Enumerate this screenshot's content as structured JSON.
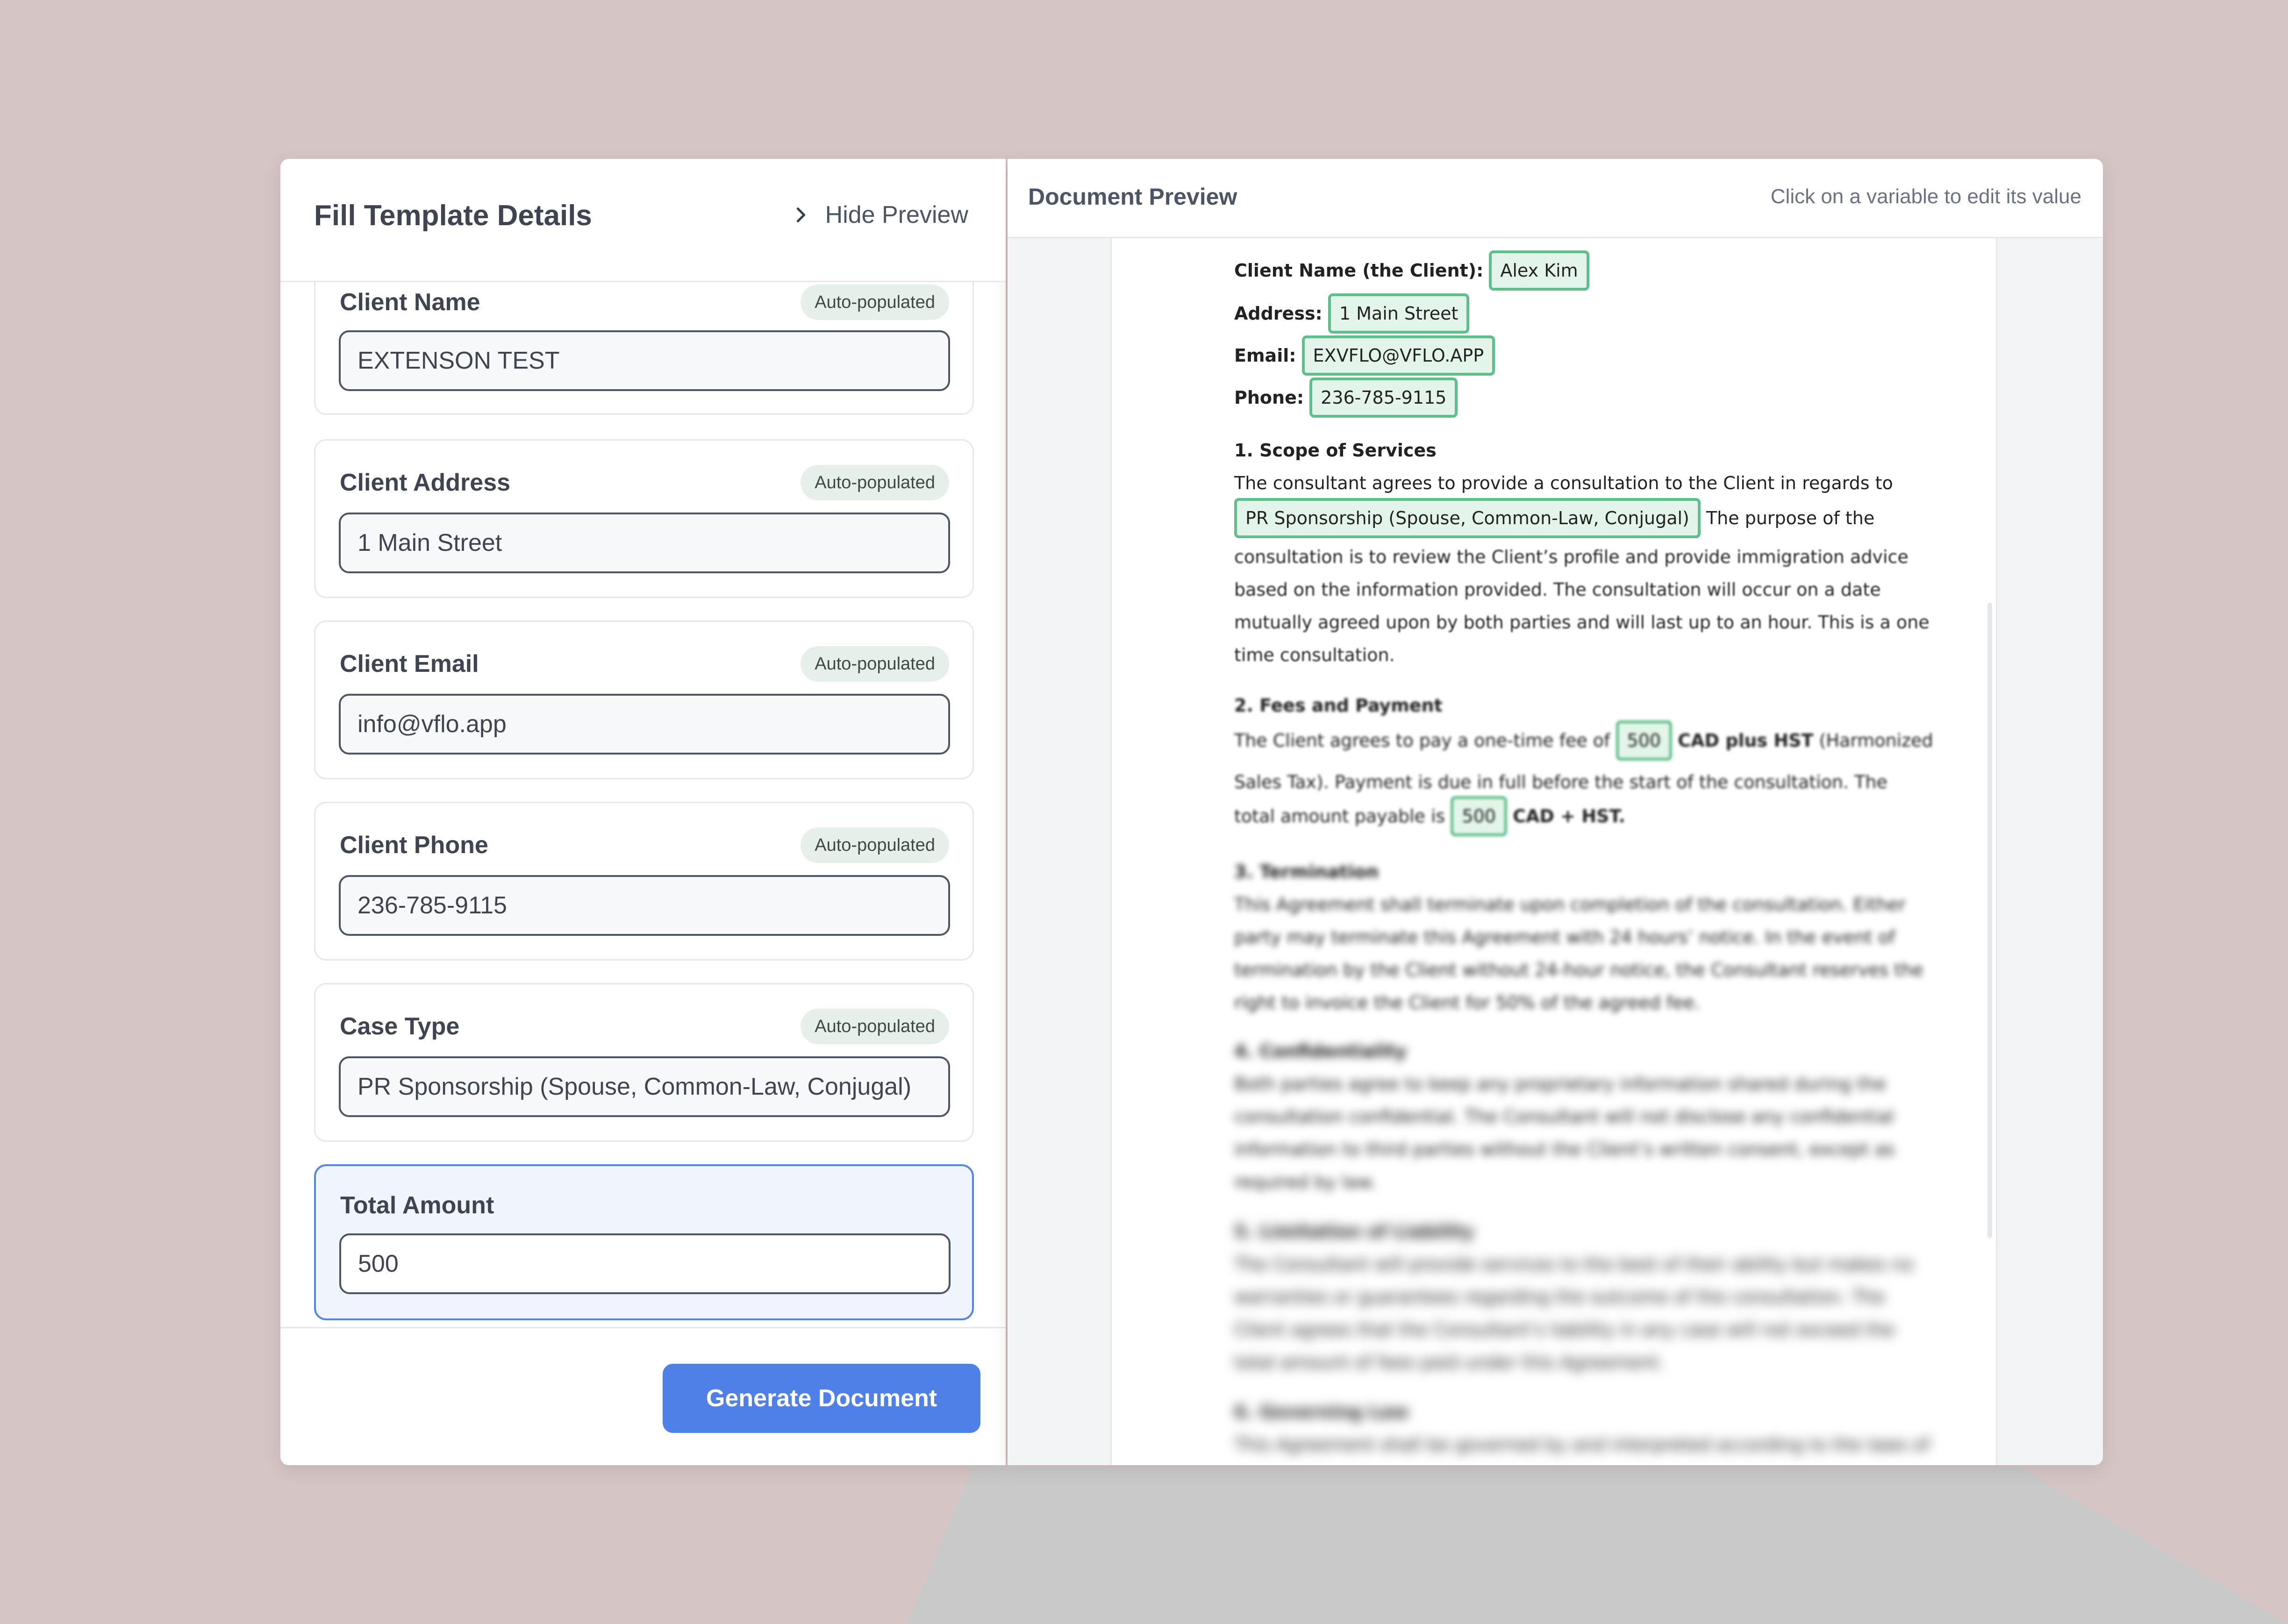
{
  "left_panel": {
    "title": "Fill Template Details",
    "hide_preview_label": "Hide Preview",
    "badge_label": "Auto-populated",
    "fields": [
      {
        "label": "Client Name",
        "value": "EXTENSON TEST",
        "auto": true
      },
      {
        "label": "Client Address",
        "value": "1 Main Street",
        "auto": true
      },
      {
        "label": "Client Email",
        "value": "info@vflo.app",
        "auto": true
      },
      {
        "label": "Client Phone",
        "value": "236-785-9115",
        "auto": true
      },
      {
        "label": "Case Type",
        "value": "PR Sponsorship (Spouse, Common-Law, Conjugal)",
        "auto": true
      },
      {
        "label": "Total Amount",
        "value": "500",
        "auto": false,
        "active": true
      }
    ],
    "generate_button": "Generate Document"
  },
  "preview": {
    "title": "Document Preview",
    "hint": "Click on a variable to edit its value",
    "client_name_label": "Client Name (the Client):",
    "client_name": "Alex Kim",
    "address_label": "Address:",
    "address": "1 Main Street",
    "email_label": "Email:",
    "email": "EXVFLO@VFLO.APP",
    "phone_label": "Phone:",
    "phone": "236-785-9115",
    "section1_title": "1. Scope of Services",
    "section1_line1": "The consultant agrees to provide a consultation to the Client in regards to",
    "case_type": "PR Sponsorship (Spouse, Common-Law, Conjugal)",
    "section1_line2_tail": "The purpose of the",
    "section1_line3": "consultation is to review the Client’s profile and provide immigration advice",
    "section1_line4": "based on the information provided. The consultation will occur on a date",
    "section1_line5": "mutually agreed upon by both parties and will last up to an hour. This is a one",
    "section1_line6": "time consultation.",
    "section2_title": "2. Fees and Payment",
    "section2_line1_pre": "The Client agrees to pay a one-time fee of",
    "fee": "500",
    "section2_line1_bold": "CAD plus HST",
    "section2_line1_post": "(Harmonized",
    "section2_line2": "Sales Tax). Payment is due in full before the start of the consultation. The",
    "section2_line3_pre": "total amount payable is",
    "total": "500",
    "section2_line3_post": "CAD + HST.",
    "section3_title": "3. Termination",
    "section3_lines": [
      "This Agreement shall terminate upon completion of the consultation. Either",
      "party may terminate this Agreement with 24 hours’ notice. In the event of",
      "termination by the Client without 24-hour notice, the Consultant reserves the",
      "right to invoice the Client for 50% of the agreed fee."
    ],
    "section4_title": "4. Confidentiality",
    "section4_lines": [
      "Both parties agree to keep any proprietary information shared during the",
      "consultation confidential. The Consultant will not disclose any confidential",
      "information to third parties without the Client’s written consent, except as",
      "required by law."
    ],
    "section5_title": "5. Limitation of Liability",
    "section5_lines": [
      "The Consultant will provide services to the best of their ability but makes no",
      "warranties or guarantees regarding the outcome of the consultation. The",
      "Client agrees that the Consultant’s liability in any case will not exceed the",
      "total amount of fees paid under this Agreement."
    ],
    "section6_title": "6. Governing Law",
    "section6_line1": "This Agreement shall be governed by and interpreted according to the laws of"
  },
  "colors": {
    "accent": "#4f80e8",
    "variable_border": "#5fbf8a",
    "variable_bg": "#e3f5ea",
    "backdrop": "#d6c5c5"
  },
  "icons": {
    "hide_preview": "chevron-right-icon"
  }
}
